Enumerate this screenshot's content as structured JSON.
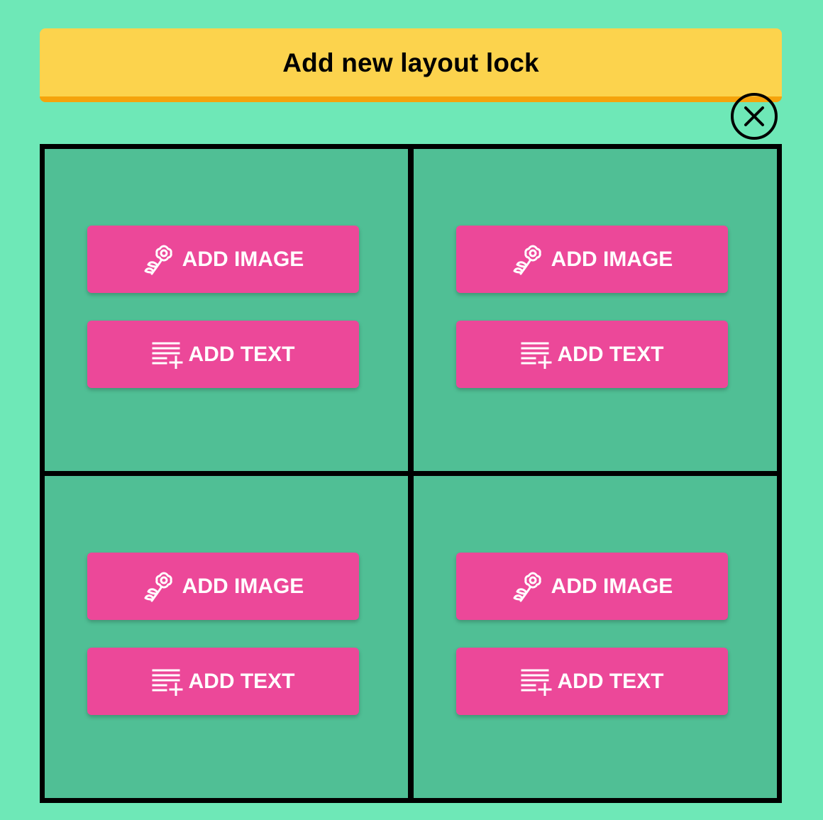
{
  "header": {
    "title": "Add new layout lock"
  },
  "close": {
    "icon": "close-icon"
  },
  "buttons": {
    "add_image_label": "ADD IMAGE",
    "add_text_label": "ADD TEXT",
    "add_image_icon": "flower-icon",
    "add_text_icon": "list-add-icon"
  },
  "colors": {
    "background": "#6ee8b7",
    "cell": "#50bf95",
    "header": "#fcd34d",
    "header_border": "#f5a30b",
    "button": "#ec4899",
    "grid_border": "#000000"
  }
}
